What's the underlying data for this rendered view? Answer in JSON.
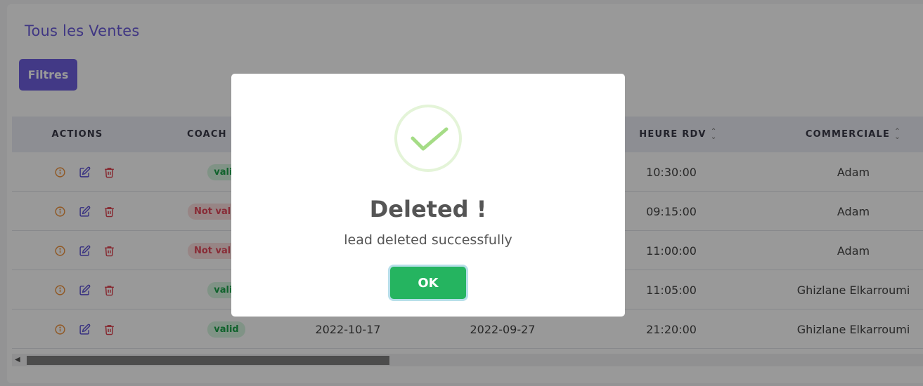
{
  "page": {
    "title": "Tous les Ventes",
    "filter_label": "Filtres"
  },
  "table": {
    "headers": {
      "actions": "ACTIONS",
      "coach": "COACH",
      "heure_rdv": "HEURE RDV",
      "commerciale": "COMMERCIALE"
    },
    "rows": [
      {
        "status": "valid",
        "status_type": "valid",
        "date1": "",
        "date2": "",
        "heure": "10:30:00",
        "commerciale": "Adam"
      },
      {
        "status": "Not vali",
        "status_type": "invalid",
        "date1": "",
        "date2": "",
        "heure": "09:15:00",
        "commerciale": "Adam"
      },
      {
        "status": "Not vali",
        "status_type": "invalid",
        "date1": "",
        "date2": "",
        "heure": "11:00:00",
        "commerciale": "Adam"
      },
      {
        "status": "valid",
        "status_type": "valid",
        "date1": "",
        "date2": "",
        "heure": "11:05:00",
        "commerciale": "Ghizlane Elkarroumi"
      },
      {
        "status": "valid",
        "status_type": "valid",
        "date1": "2022-10-17",
        "date2": "2022-09-27",
        "heure": "21:20:00",
        "commerciale": "Ghizlane Elkarroumi"
      }
    ]
  },
  "modal": {
    "title": "Deleted !",
    "message": "lead deleted successfully",
    "ok_label": "OK",
    "icon": "success-check-icon"
  },
  "colors": {
    "accent": "#6e5fe0",
    "info_icon": "#f0913a",
    "edit_icon": "#5b4fd6",
    "delete_icon": "#e0424f",
    "ok_button": "#25b460"
  }
}
